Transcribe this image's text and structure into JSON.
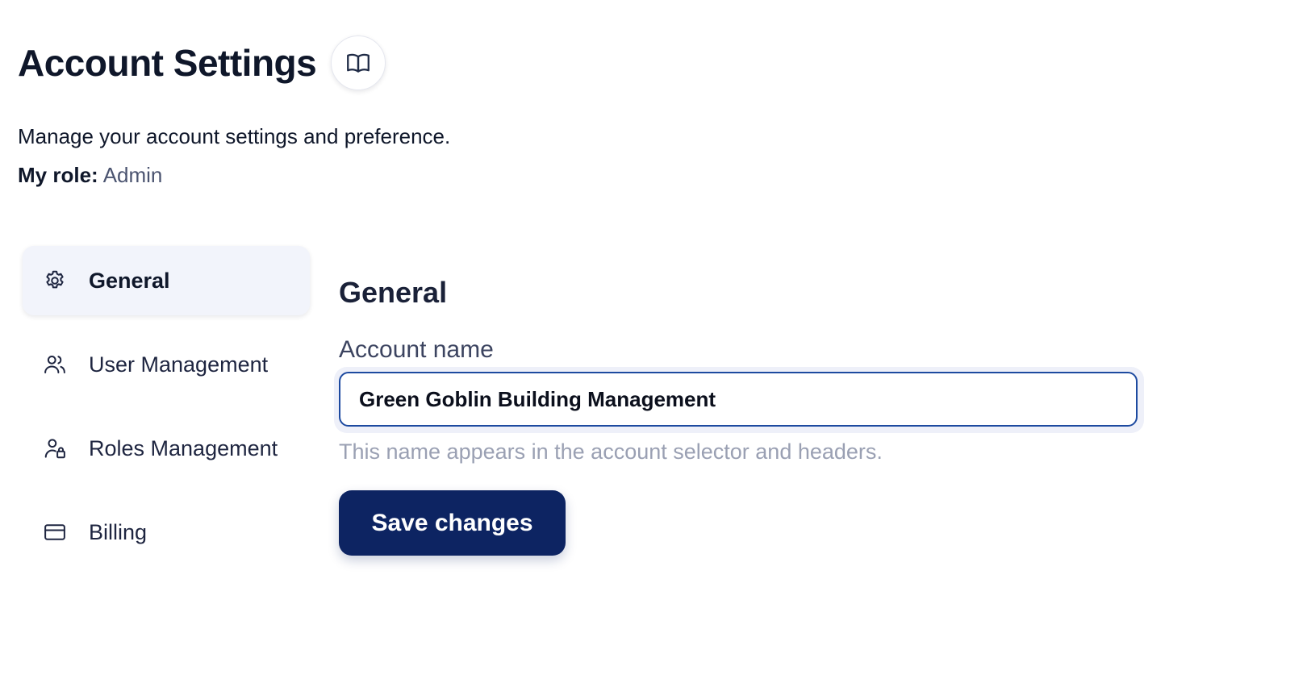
{
  "header": {
    "title": "Account Settings",
    "docs_icon": "book-open-icon"
  },
  "subtitle": "Manage your account settings and preference.",
  "role": {
    "label": "My role:",
    "value": "Admin"
  },
  "sidebar": {
    "items": [
      {
        "label": "General",
        "icon": "gear-icon",
        "active": true
      },
      {
        "label": "User Management",
        "icon": "users-icon",
        "active": false
      },
      {
        "label": "Roles Management",
        "icon": "user-lock-icon",
        "active": false
      },
      {
        "label": "Billing",
        "icon": "credit-card-icon",
        "active": false
      }
    ]
  },
  "general": {
    "section_title": "General",
    "account_name_label": "Account name",
    "account_name_value": "Green Goblin Building Management",
    "helper_text": "This name appears in the account selector and headers.",
    "save_label": "Save changes"
  },
  "colors": {
    "primary": "#0d2462",
    "input_border": "#1d4aa0",
    "active_nav_bg": "#f2f4fb",
    "helper_text": "#9aa0b3"
  }
}
